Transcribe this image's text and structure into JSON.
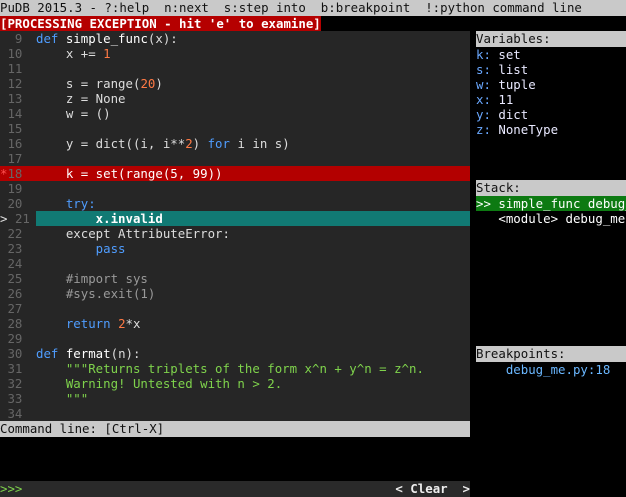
{
  "header": {
    "text": "PuDB 2015.3 - ?:help  n:next  s:step into  b:breakpoint  !:python command line"
  },
  "exception": {
    "text": "[PROCESSING EXCEPTION - hit 'e' to examine]"
  },
  "code": {
    "lines": [
      {
        "num": "9"
      },
      {
        "num": "10"
      },
      {
        "num": "11"
      },
      {
        "num": "12"
      },
      {
        "num": "13"
      },
      {
        "num": "14"
      },
      {
        "num": "15"
      },
      {
        "num": "16"
      },
      {
        "num": "17"
      },
      {
        "num": "18",
        "marker": "*"
      },
      {
        "num": "19"
      },
      {
        "num": "20"
      },
      {
        "num": "21",
        "marker": ">"
      },
      {
        "num": "22"
      },
      {
        "num": "23"
      },
      {
        "num": "24"
      },
      {
        "num": "25"
      },
      {
        "num": "26"
      },
      {
        "num": "27"
      },
      {
        "num": "28"
      },
      {
        "num": "29"
      },
      {
        "num": "30"
      },
      {
        "num": "31"
      },
      {
        "num": "32"
      },
      {
        "num": "33"
      },
      {
        "num": "34"
      }
    ],
    "l9_def": "def ",
    "l9_name": "simple_func",
    "l9_rest": "(x):",
    "l10_a": "    x += ",
    "l10_num": "1",
    "l12_a": "    s = range(",
    "l12_num": "20",
    "l12_b": ")",
    "l13": "    z = None",
    "l14": "    w = ()",
    "l16_a": "    y = dict((i, i**",
    "l16_num": "2",
    "l16_b": ") ",
    "l16_kw": "for",
    "l16_c": " i in s)",
    "l18_a": "    k = set(range(5, 99))",
    "l20_kw": "    try:",
    "l21": "        x.invalid",
    "l22_a": "    except AttributeError:",
    "l23": "        pass",
    "l25": "    #import sys",
    "l26": "    #sys.exit(1)",
    "l28_a": "    return ",
    "l28_num": "2",
    "l28_b": "*x",
    "l30_def": "def ",
    "l30_name": "fermat",
    "l30_rest": "(n):",
    "l31": "    \"\"\"Returns triplets of the form x^n + y^n = z^n.",
    "l32": "    Warning! Untested with n > 2.",
    "l33": "    \"\"\""
  },
  "variables": {
    "title": "Variables:",
    "items": [
      {
        "k": "k:",
        "v": " set"
      },
      {
        "k": "s:",
        "v": " list"
      },
      {
        "k": "w:",
        "v": " tuple"
      },
      {
        "k": "x:",
        "v": " 11"
      },
      {
        "k": "y:",
        "v": " dict"
      },
      {
        "k": "z:",
        "v": " NoneType"
      }
    ]
  },
  "stack": {
    "title": "Stack:",
    "items": [
      ">> simple_func debug_",
      "   <module> debug_me."
    ]
  },
  "breakpoints": {
    "title": "Breakpoints:",
    "items": [
      "    debug_me.py:18"
    ]
  },
  "command": {
    "title": "Command line: [Ctrl-X]",
    "prompt": ">>>",
    "clear_label": "< Clear  >"
  },
  "colors": {
    "exception_bg": "#b50000",
    "breakpoint_line": "#b30000",
    "current_line": "#117a74",
    "stack_selected": "#0d7a12"
  }
}
